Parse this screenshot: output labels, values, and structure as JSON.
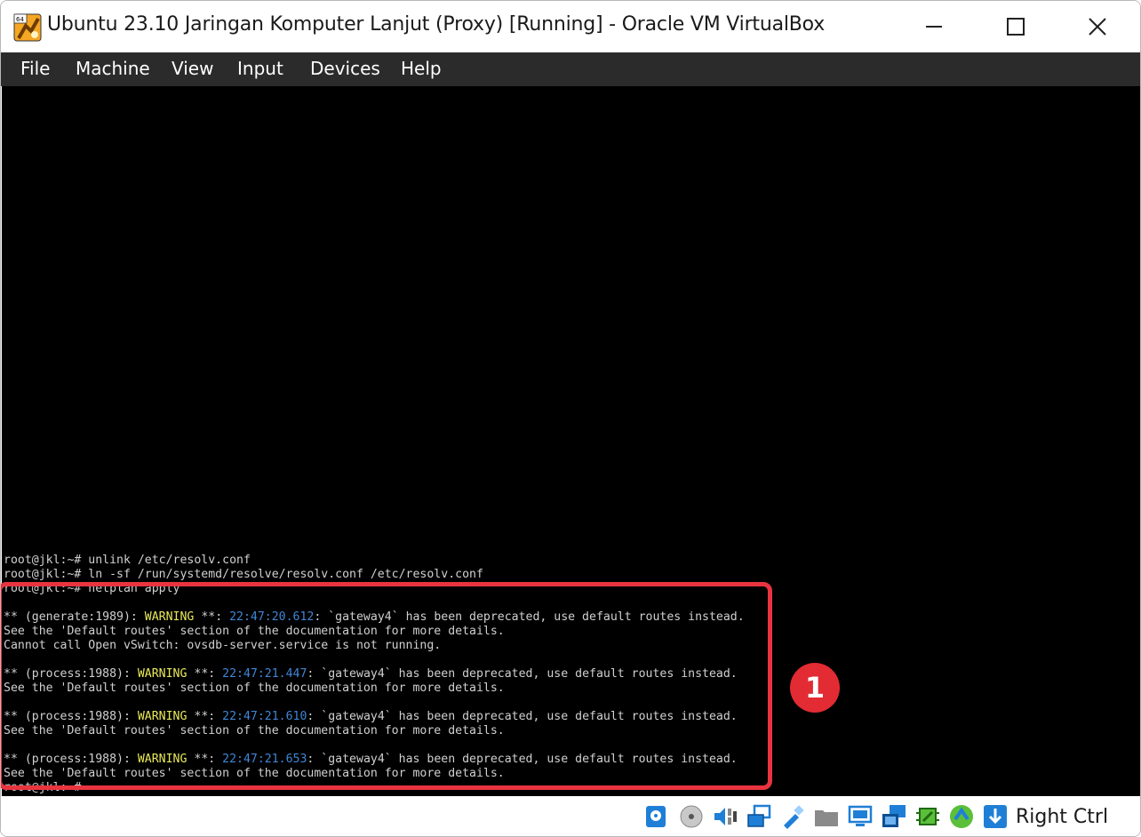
{
  "window": {
    "title": "Ubuntu 23.10 Jaringan Komputer Lanjut (Proxy) [Running] - Oracle VM VirtualBox",
    "app_icon": "virtualbox-64-icon",
    "controls": [
      "minimize-icon",
      "maximize-icon",
      "close-icon"
    ]
  },
  "menubar": {
    "items": [
      "File",
      "Machine",
      "View",
      "Input",
      "Devices",
      "Help"
    ]
  },
  "terminal": {
    "lines": [
      {
        "segments": [
          {
            "text": "root@jkl:~# unlink /etc/resolv.conf"
          }
        ]
      },
      {
        "segments": [
          {
            "text": "root@jkl:~# ln -sf /run/systemd/resolve/resolv.conf /etc/resolv.conf"
          }
        ]
      },
      {
        "segments": [
          {
            "text": "root@jkl:~# netplan apply"
          }
        ]
      },
      {
        "segments": [
          {
            "text": ""
          }
        ]
      },
      {
        "segments": [
          {
            "text": "** (generate:1989): "
          },
          {
            "text": "WARNING",
            "cls": "warn"
          },
          {
            "text": " **: "
          },
          {
            "text": "22:47:20.612",
            "cls": "ts"
          },
          {
            "text": ": `gateway4` has been deprecated, use default routes instead."
          }
        ]
      },
      {
        "segments": [
          {
            "text": "See the 'Default routes' section of the documentation for more details."
          }
        ]
      },
      {
        "segments": [
          {
            "text": "Cannot call Open vSwitch: ovsdb-server.service is not running."
          }
        ]
      },
      {
        "segments": [
          {
            "text": ""
          }
        ]
      },
      {
        "segments": [
          {
            "text": "** (process:1988): "
          },
          {
            "text": "WARNING",
            "cls": "warn"
          },
          {
            "text": " **: "
          },
          {
            "text": "22:47:21.447",
            "cls": "ts"
          },
          {
            "text": ": `gateway4` has been deprecated, use default routes instead."
          }
        ]
      },
      {
        "segments": [
          {
            "text": "See the 'Default routes' section of the documentation for more details."
          }
        ]
      },
      {
        "segments": [
          {
            "text": ""
          }
        ]
      },
      {
        "segments": [
          {
            "text": "** (process:1988): "
          },
          {
            "text": "WARNING",
            "cls": "warn"
          },
          {
            "text": " **: "
          },
          {
            "text": "22:47:21.610",
            "cls": "ts"
          },
          {
            "text": ": `gateway4` has been deprecated, use default routes instead."
          }
        ]
      },
      {
        "segments": [
          {
            "text": "See the 'Default routes' section of the documentation for more details."
          }
        ]
      },
      {
        "segments": [
          {
            "text": ""
          }
        ]
      },
      {
        "segments": [
          {
            "text": "** (process:1988): "
          },
          {
            "text": "WARNING",
            "cls": "warn"
          },
          {
            "text": " **: "
          },
          {
            "text": "22:47:21.653",
            "cls": "ts"
          },
          {
            "text": ": `gateway4` has been deprecated, use default routes instead."
          }
        ]
      },
      {
        "segments": [
          {
            "text": "See the 'Default routes' section of the documentation for more details."
          }
        ]
      },
      {
        "segments": [
          {
            "text": "root@jkl:~#"
          }
        ]
      }
    ]
  },
  "annotation": {
    "badge_number": "1",
    "color": "#e22b33"
  },
  "statusbar": {
    "icons": [
      "hard-disk-icon",
      "optical-drive-icon",
      "audio-icon",
      "network-icon",
      "usb-icon",
      "shared-folders-icon",
      "display-icon",
      "recording-icon",
      "cpu-icon",
      "mouse-integration-icon",
      "keyboard-capture-icon"
    ],
    "host_key": "Right Ctrl"
  },
  "colors": {
    "menubar_bg": "#2b2b2b",
    "terminal_bg": "#000000",
    "terminal_text": "#d0d0d0",
    "warning": "#e8e85a",
    "timestamp": "#3f86d6",
    "highlight": "#e8343f"
  }
}
